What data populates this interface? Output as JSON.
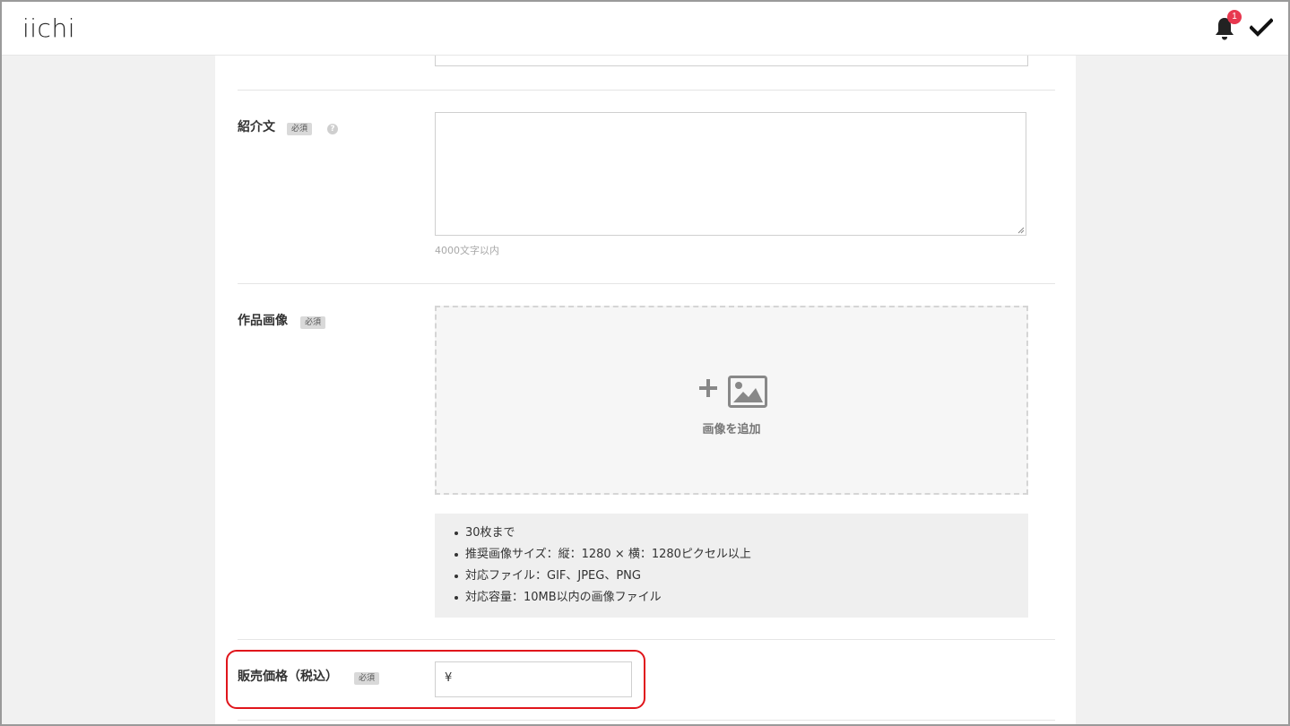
{
  "header": {
    "logo": "iichi",
    "notification_count": "1",
    "icons": {
      "bell": "bell-icon",
      "check": "check-icon"
    },
    "badge_color": "#e8384f"
  },
  "form": {
    "description": {
      "label": "紹介文",
      "required": "必須",
      "help": "?",
      "hint": "4000文字以内",
      "value": ""
    },
    "images": {
      "label": "作品画像",
      "required": "必須",
      "add_label": "画像を追加",
      "notes": [
        "30枚まで",
        "推奨画像サイズ：縦：1280 × 横：1280ピクセル以上",
        "対応ファイル：GIF、JPEG、PNG",
        "対応容量：10MB以内の画像ファイル"
      ]
    },
    "price": {
      "label": "販売価格（税込）",
      "required": "必須",
      "prefix": "¥",
      "value": ""
    }
  },
  "highlight_color": "#e0151b"
}
